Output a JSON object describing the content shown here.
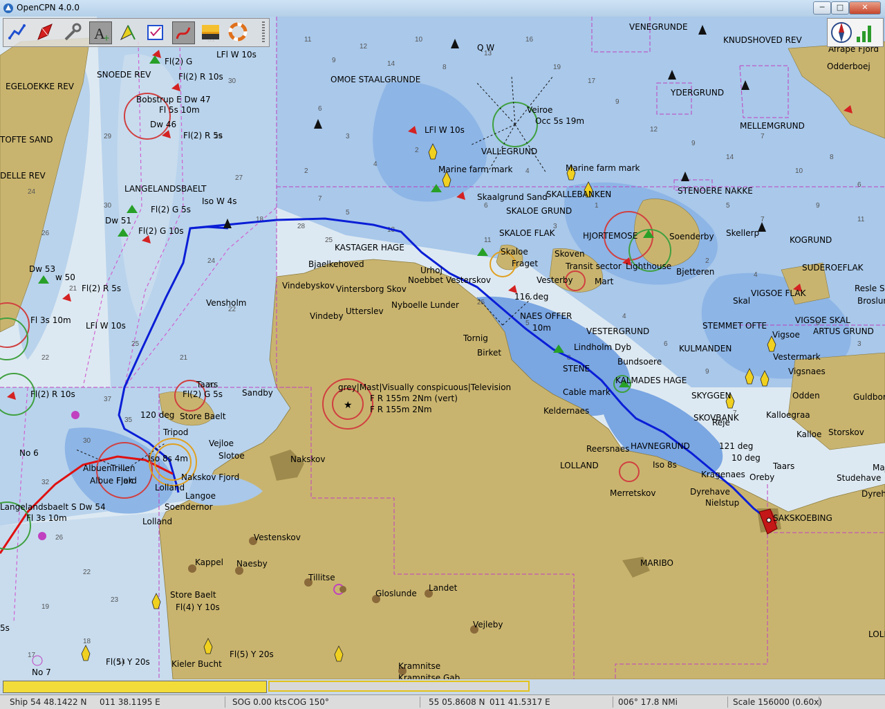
{
  "window": {
    "title": "OpenCPN 4.0.0",
    "min_label": "─",
    "max_label": "□",
    "close_label": "✕"
  },
  "toolbar": {
    "tools": [
      {
        "name": "route-manager-icon",
        "active": false
      },
      {
        "name": "new-route-icon",
        "active": false
      },
      {
        "name": "settings-wrench-icon",
        "active": false
      },
      {
        "name": "add-text-icon",
        "active": true
      },
      {
        "name": "mark-icon",
        "active": false
      },
      {
        "name": "chart-quilting-icon",
        "active": false
      },
      {
        "name": "track-icon",
        "active": true
      },
      {
        "name": "day-night-icon",
        "active": false
      },
      {
        "name": "man-overboard-icon",
        "active": false
      }
    ]
  },
  "chart_labels": [
    {
      "text": "VENEGRUNDE"
    },
    {
      "text": "Q W"
    },
    {
      "text": "KNUDSHOVED REV"
    },
    {
      "text": "Afrape Fjord"
    },
    {
      "text": "Odderboej"
    },
    {
      "text": "OMOE STAALGRUNDE"
    },
    {
      "text": "YDERGRUND"
    },
    {
      "text": "MELLEMGRUND"
    },
    {
      "text": "EGELOEKKE REV"
    },
    {
      "text": "SNOEDE REV"
    },
    {
      "text": "Fl(2) G"
    },
    {
      "text": "LFl W 10s"
    },
    {
      "text": "Fl(2) R 10s"
    },
    {
      "text": "Bobstrup E Dw 47"
    },
    {
      "text": "Fl 5s 10m"
    },
    {
      "text": "Dw 46"
    },
    {
      "text": "Fl(2) R 5s"
    },
    {
      "text": "TOFTE SAND"
    },
    {
      "text": "DELLE REV"
    },
    {
      "text": "LANGELANDSBAELT"
    },
    {
      "text": "Iso W 4s"
    },
    {
      "text": "Fl(2) G 5s"
    },
    {
      "text": "Dw 51"
    },
    {
      "text": "Fl(2) G 10s"
    },
    {
      "text": "Veiroe"
    },
    {
      "text": "Occ 5s 19m"
    },
    {
      "text": "LFl W 10s"
    },
    {
      "text": "VALLEGRUND"
    },
    {
      "text": "Marine farm mark"
    },
    {
      "text": "Marine farm mark"
    },
    {
      "text": "SKALLEBANKEN"
    },
    {
      "text": "STENOERE NAKKE"
    },
    {
      "text": "Skaalgrund Sand"
    },
    {
      "text": "SKALOE GRUND"
    },
    {
      "text": "SKALOE FLAK"
    },
    {
      "text": "HJORTEMOSE"
    },
    {
      "text": "Soenderby"
    },
    {
      "text": "Skellerp"
    },
    {
      "text": "KOGRUND"
    },
    {
      "text": "KASTAGER HAGE"
    },
    {
      "text": "Bjaelkehoved"
    },
    {
      "text": "Skaloe"
    },
    {
      "text": "Fraget"
    },
    {
      "text": "Skoven"
    },
    {
      "text": "Transit sector"
    },
    {
      "text": "Lighthouse"
    },
    {
      "text": "Vesterby"
    },
    {
      "text": "Bjetteren"
    },
    {
      "text": "SUDEROEFLAK"
    },
    {
      "text": "Resle Se"
    },
    {
      "text": "Broslun"
    },
    {
      "text": "Dw 53"
    },
    {
      "text": "w 50"
    },
    {
      "text": "Fl(2) R 5s"
    },
    {
      "text": "Vindebyskov"
    },
    {
      "text": "Vintersborg Skov"
    },
    {
      "text": "Noebbet Vesterskov"
    },
    {
      "text": "Urhoj"
    },
    {
      "text": "116 deg"
    },
    {
      "text": "Vensholm"
    },
    {
      "text": "Nyboelle Lunder"
    },
    {
      "text": "VIGSOE FLAK"
    },
    {
      "text": "VIGSOE SKAL"
    },
    {
      "text": "ARTUS GRUND"
    },
    {
      "text": "Vindeby"
    },
    {
      "text": "Utterslev"
    },
    {
      "text": "NAES OFFER"
    },
    {
      "text": "VESTERGRUND"
    },
    {
      "text": "STEMMET OFTE"
    },
    {
      "text": "Vigsoe"
    },
    {
      "text": "Fl 3s 10m"
    },
    {
      "text": "LFl W 10s"
    },
    {
      "text": "Tornig"
    },
    {
      "text": "10m"
    },
    {
      "text": "Lindholm Dyb"
    },
    {
      "text": "KULMANDEN"
    },
    {
      "text": "Vestermark"
    },
    {
      "text": "Birket"
    },
    {
      "text": "Bundsoere"
    },
    {
      "text": "Vigsnaes"
    },
    {
      "text": "Fl(2) R 10s"
    },
    {
      "text": "Taars"
    },
    {
      "text": "Sandby"
    },
    {
      "text": "grey|Mast|Visually conspicuous|Television"
    },
    {
      "text": "F R 155m 2Nm (vert)"
    },
    {
      "text": "F R 155m 2Nm"
    },
    {
      "text": "STENE"
    },
    {
      "text": "Cable mark"
    },
    {
      "text": "KALMADES HAGE"
    },
    {
      "text": "SKYGGEN"
    },
    {
      "text": "Odden"
    },
    {
      "text": "Guldbor"
    },
    {
      "text": "Fl(2) G 5s"
    },
    {
      "text": "120 deg"
    },
    {
      "text": "Store Baelt"
    },
    {
      "text": "Keldernaes"
    },
    {
      "text": "SKOVBANK"
    },
    {
      "text": "Kalloegraa"
    },
    {
      "text": "Kalloe"
    },
    {
      "text": "Storskov"
    },
    {
      "text": "Tripod"
    },
    {
      "text": "Vejloe"
    },
    {
      "text": "No 6"
    },
    {
      "text": "Iso 8s 4m"
    },
    {
      "text": "Slotoe"
    },
    {
      "text": "Nakskov"
    },
    {
      "text": "Reersnaes"
    },
    {
      "text": "HAVNEGRUND"
    },
    {
      "text": "121 deg"
    },
    {
      "text": "10 deg"
    },
    {
      "text": "Albuen"
    },
    {
      "text": "Trillen"
    },
    {
      "text": "Fjord"
    },
    {
      "text": "Nakskov Fjord"
    },
    {
      "text": "LOLLAND"
    },
    {
      "text": "Iso 8s"
    },
    {
      "text": "Kragenaes"
    },
    {
      "text": "Oreby"
    },
    {
      "text": "Taars"
    },
    {
      "text": "Studehave"
    },
    {
      "text": "Dyreh"
    },
    {
      "text": "Albue Flak"
    },
    {
      "text": "Lolland"
    },
    {
      "text": "Langoe"
    },
    {
      "text": "Merretskov"
    },
    {
      "text": "Dyrehave"
    },
    {
      "text": "Nielstup"
    },
    {
      "text": "SAKSKOEBING"
    },
    {
      "text": "Langelandsbaelt S Dw 54"
    },
    {
      "text": "Soendernor"
    },
    {
      "text": "Fl 3s 10m"
    },
    {
      "text": "Lolland"
    },
    {
      "text": "Vestenskov"
    },
    {
      "text": "MARIBO"
    },
    {
      "text": "Kappel"
    },
    {
      "text": "Naesby"
    },
    {
      "text": "Tillitse"
    },
    {
      "text": "Landet"
    },
    {
      "text": "Gloslunde"
    },
    {
      "text": "5s"
    },
    {
      "text": "Store Baelt"
    },
    {
      "text": "Fl(4) Y 10s"
    },
    {
      "text": "Vejleby"
    },
    {
      "text": "LOLI"
    },
    {
      "text": "No 7"
    },
    {
      "text": "Fl(5) Y 20s"
    },
    {
      "text": "Fl(5) Y 20s"
    },
    {
      "text": "Kieler Bucht"
    },
    {
      "text": "Kramnitse"
    },
    {
      "text": "Kramnitse Gab"
    },
    {
      "text": "Majb"
    },
    {
      "text": "Skal"
    },
    {
      "text": "Mart"
    },
    {
      "text": "Reje"
    }
  ],
  "route": {
    "color": "#0a1ed6"
  },
  "track": {
    "color": "#e01010"
  },
  "colors": {
    "land": "#c9b46f",
    "deep": "#dde9f2",
    "mid": "#b2cfe8",
    "shallow": "#7da9e3",
    "dredged": "#5b8fe0",
    "ownship": "#c41717"
  },
  "progress": {
    "left_fill": 1.0,
    "right_fill": 0.0
  },
  "status": {
    "ship": "Ship 54 48.1422 N",
    "ship_lon": "011 38.1195 E",
    "sog": "SOG 0.00 kts",
    "cog": "COG 150°",
    "cursor_lat": "55 05.8608 N",
    "cursor_lon": "011 41.5317 E",
    "brg_dist": "006°  17.8 NMi",
    "scale": "Scale 156000 (0.60x)"
  }
}
